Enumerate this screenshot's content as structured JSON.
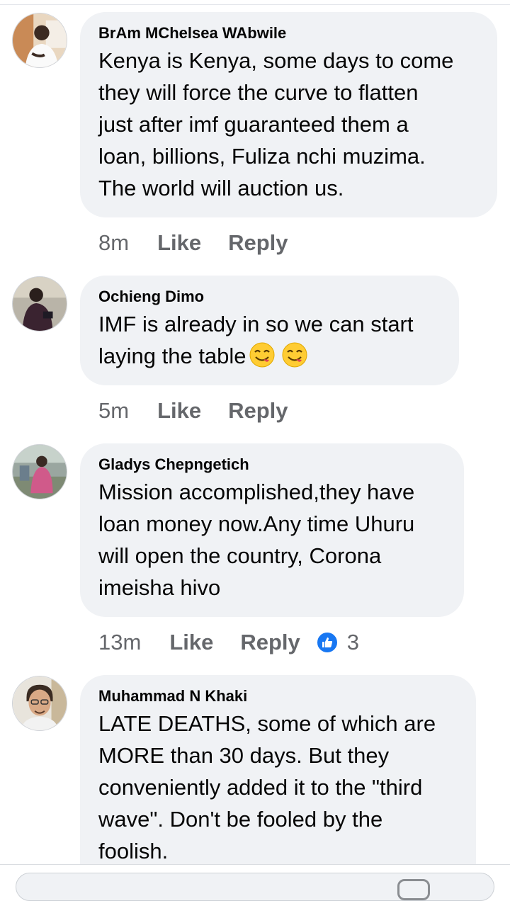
{
  "comments": [
    {
      "author": "BrAm MChelsea WAbwile",
      "text": "Kenya is Kenya, some days to come\nthey will force the curve to flatten\njust after imf guaranteed them a\nloan, billions, Fuliza nchi muzima.\nThe world will auction us.",
      "time": "8m",
      "like_label": "Like",
      "reply_label": "Reply"
    },
    {
      "author": "Ochieng Dimo",
      "text": "IMF is already in so we can start\nlaying  the table",
      "emojis": [
        "face-savoring-food-emoji",
        "face-savoring-food-emoji"
      ],
      "time": "5m",
      "like_label": "Like",
      "reply_label": "Reply"
    },
    {
      "author": "Gladys Chepngetich",
      "text": "Mission accomplished,they have\nloan money now.Any time Uhuru\nwill open the country, Corona\nimeisha hivo",
      "time": "13m",
      "like_label": "Like",
      "reply_label": "Reply",
      "reaction_icon": "thumbs-up-icon",
      "reaction_count": "3"
    },
    {
      "author": "Muhammad N Khaki",
      "text": "LATE DEATHS, some of which are\nMORE than 30 days. But they\nconveniently added it to the \"third\nwave\". Don't be fooled by the\nfoolish."
    }
  ],
  "colors": {
    "bubble": "#f0f2f5",
    "meta": "#65676b",
    "reaction": "#1877f2"
  }
}
